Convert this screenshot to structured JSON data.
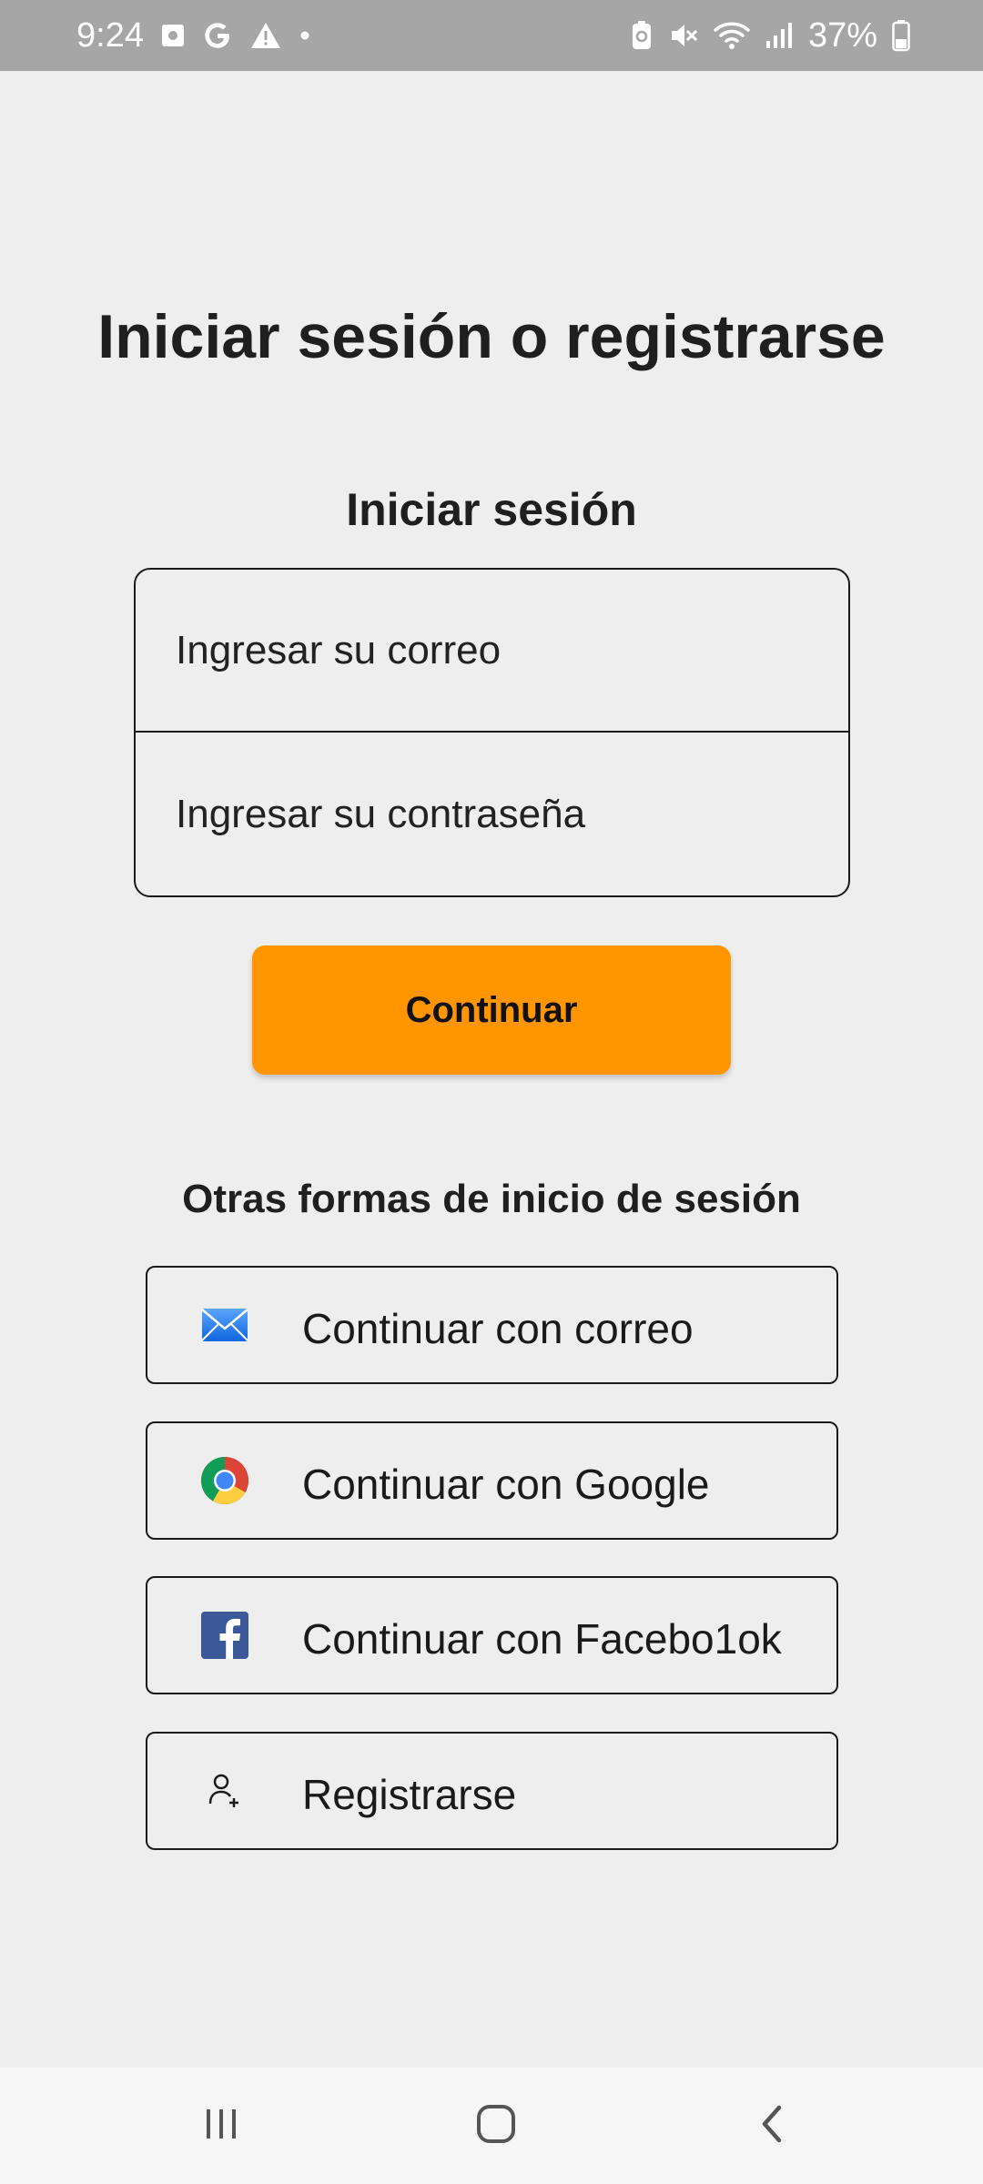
{
  "status_bar": {
    "time": "9:24",
    "left_icons": [
      "photo-notification-icon",
      "google-icon",
      "warning-icon",
      "dot-icon"
    ],
    "right_icons": [
      "battery-saver-icon",
      "mute-icon",
      "wifi-icon",
      "signal-icon",
      "battery-icon"
    ],
    "battery_percent": "37%"
  },
  "page": {
    "title": "Iniciar sesión o registrarse"
  },
  "login": {
    "title": "Iniciar sesión",
    "email_placeholder": "Ingresar su correo",
    "password_placeholder": "Ingresar su contraseña",
    "continue_label": "Continuar"
  },
  "other_methods": {
    "title": "Otras formas de inicio de sesión",
    "buttons": [
      {
        "label": "Continuar con correo",
        "icon": "mail-icon"
      },
      {
        "label": "Continuar con Google",
        "icon": "chrome-icon"
      },
      {
        "label": "Continuar con Facebo1ok",
        "icon": "facebook-icon"
      },
      {
        "label": "Registrarse",
        "icon": "add-user-icon"
      }
    ]
  },
  "nav_bar": {
    "icons": [
      "recents-icon",
      "home-icon",
      "back-icon"
    ]
  },
  "colors": {
    "background": "#eeeeee",
    "status_bar": "#a6a6a6",
    "accent": "#ff9500",
    "nav_bar": "#f6f6f6",
    "text": "#1f1f1f"
  }
}
